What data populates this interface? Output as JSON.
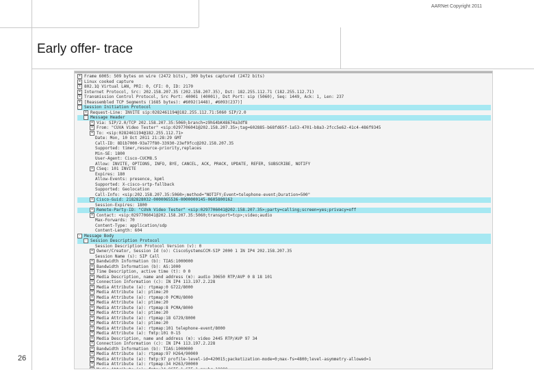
{
  "header": {
    "copyright": "AARNet Copyright 2011"
  },
  "slide": {
    "title": "Early offer- trace",
    "page_number": "26"
  },
  "packet_tree": [
    {
      "indent": 0,
      "expander": "+",
      "text": "Frame 6005: 509 bytes on wire (2472 bits), 309 bytes captured (2472 bits)",
      "highlight": false
    },
    {
      "indent": 0,
      "expander": "+",
      "text": "Linux cooked capture",
      "highlight": false
    },
    {
      "indent": 0,
      "expander": "+",
      "text": "802.1Q Virtual LAN, PRI: 0, CFI: 0, ID: 2170",
      "highlight": false
    },
    {
      "indent": 0,
      "expander": "+",
      "text": "Internet Protocol, Src: 202.158.207.35 (202.158.207.35), Dst: 182.255.112.71 (182.255.112.71)",
      "highlight": false
    },
    {
      "indent": 0,
      "expander": "+",
      "text": "Transmission Control Protocol, Src Port: 40001 (40001), Dst Port: sip (5060), Seq: 1449, Ack: 1, Len: 237",
      "highlight": false
    },
    {
      "indent": 0,
      "expander": "+",
      "text": "[Reassembled TCP Segments (1685 bytes): #6092(1448), #6093(237)]",
      "highlight": false
    },
    {
      "indent": 0,
      "expander": "-",
      "text": "Session Initiation Protocol",
      "highlight": true
    },
    {
      "indent": 1,
      "expander": "+",
      "text": "Request-Line: INVITE sip:0282461194@182.255.112.71:5060 SIP/2.0",
      "highlight": false
    },
    {
      "indent": 1,
      "expander": "-",
      "text": "Message Header",
      "highlight": true
    },
    {
      "indent": 2,
      "expander": "+",
      "text": "Via: SIP/2.0/TCP 202.158.207.35:5060;branch=z9hG4bK48674a3df8",
      "highlight": false
    },
    {
      "indent": 2,
      "expander": "+",
      "text": "From: \"CUVA Video Tester\" <sip:0297706041@202.158.207.35>;tag=602885-b68fd65f-1a53-4701-b8a3-2fcc5e62-41c4-486f9345",
      "highlight": false
    },
    {
      "indent": 2,
      "expander": "+",
      "text": "To: <sip:0282461194@182.255.112.71>",
      "highlight": false
    },
    {
      "indent": 2,
      "expander": "none",
      "text": "Date: Mon, 10 Oct 2011 21:28:29 GMT",
      "highlight": false
    },
    {
      "indent": 2,
      "expander": "none",
      "text": "Call-ID: 8D1b7000-93a77f80-33930-23ef9fcc@202.158.207.35",
      "highlight": false
    },
    {
      "indent": 2,
      "expander": "none",
      "text": "Supported: timer,resource-priority,replaces",
      "highlight": false
    },
    {
      "indent": 2,
      "expander": "none",
      "text": "Min-SE: 1800",
      "highlight": false
    },
    {
      "indent": 2,
      "expander": "none",
      "text": "User-Agent: Cisco-CUCM8.5",
      "highlight": false
    },
    {
      "indent": 2,
      "expander": "none",
      "text": "Allow: INVITE, OPTIONS, INFO, BYE, CANCEL, ACK, PRACK, UPDATE, REFER, SUBSCRIBE, NOTIFY",
      "highlight": false
    },
    {
      "indent": 2,
      "expander": "+",
      "text": "CSeq: 101 INVITE",
      "highlight": false
    },
    {
      "indent": 2,
      "expander": "none",
      "text": "Expires: 180",
      "highlight": false
    },
    {
      "indent": 2,
      "expander": "none",
      "text": "Allow-Events: presence, kpml",
      "highlight": false
    },
    {
      "indent": 2,
      "expander": "none",
      "text": "Supported: X-cisco-srtp-fallback",
      "highlight": false
    },
    {
      "indent": 2,
      "expander": "none",
      "text": "Supported: Geolocation",
      "highlight": false
    },
    {
      "indent": 2,
      "expander": "none",
      "text": "Call-Info: <sip:202.158.207.35:5060>;method=\"NOTIFY;Event=telephone-event;Duration=500\"",
      "highlight": false
    },
    {
      "indent": 2,
      "expander": "+",
      "text": "Cisco-Guid: 2182828032-0000065536-0000000145-0605800162",
      "highlight": true
    },
    {
      "indent": 2,
      "expander": "none",
      "text": "Session-Expires: 1800",
      "highlight": false
    },
    {
      "indent": 2,
      "expander": "+",
      "text": "Remote-Party-ID: \"CUVA Video Tester\" <sip:0297706041@202.158.207.35>;party=calling;screen=yes;privacy=off",
      "highlight": true
    },
    {
      "indent": 2,
      "expander": "+",
      "text": "Contact: <sip:0297706041@202.158.207.35:5060;transport=tcp>;video;audio",
      "highlight": false
    },
    {
      "indent": 2,
      "expander": "none",
      "text": "Max-Forwards: 70",
      "highlight": false
    },
    {
      "indent": 2,
      "expander": "none",
      "text": "Content-Type: application/sdp",
      "highlight": false
    },
    {
      "indent": 2,
      "expander": "none",
      "text": "Content-Length: 604",
      "highlight": false
    },
    {
      "indent": 0,
      "expander": "-",
      "text": "Message Body",
      "highlight": true
    },
    {
      "indent": 1,
      "expander": "-",
      "text": "Session Description Protocol",
      "highlight": true
    },
    {
      "indent": 2,
      "expander": "none",
      "text": "Session Description Protocol Version (v): 0",
      "highlight": false
    },
    {
      "indent": 2,
      "expander": "+",
      "text": "Owner/Creator, Session Id (o): CiscoSystemsCCM-SIP 2000 1 IN IP4 202.158.207.35",
      "highlight": false
    },
    {
      "indent": 2,
      "expander": "none",
      "text": "Session Name (s): SIP Call",
      "highlight": false
    },
    {
      "indent": 2,
      "expander": "+",
      "text": "Bandwidth Information (b): TIAS:1000000",
      "highlight": false
    },
    {
      "indent": 2,
      "expander": "+",
      "text": "Bandwidth Information (b): AS:1000",
      "highlight": false
    },
    {
      "indent": 2,
      "expander": "+",
      "text": "Time Description, active time (t): 0 0",
      "highlight": false
    },
    {
      "indent": 2,
      "expander": "+",
      "text": "Media Description, name and address (m): audio 30650 RTP/AVP 0 8 18 101",
      "highlight": false
    },
    {
      "indent": 2,
      "expander": "+",
      "text": "Connection Information (c): IN IP4 113.197.2.228",
      "highlight": false
    },
    {
      "indent": 2,
      "expander": "+",
      "text": "Media Attribute (a): rtpmap:0 G722/8000",
      "highlight": false
    },
    {
      "indent": 2,
      "expander": "+",
      "text": "Media Attribute (a): ptime:20",
      "highlight": false
    },
    {
      "indent": 2,
      "expander": "+",
      "text": "Media Attribute (a): rtpmap:0 PCMU/8000",
      "highlight": false
    },
    {
      "indent": 2,
      "expander": "+",
      "text": "Media Attribute (a): ptime:20",
      "highlight": false
    },
    {
      "indent": 2,
      "expander": "+",
      "text": "Media Attribute (a): rtpmap:8 PCMA/8000",
      "highlight": false
    },
    {
      "indent": 2,
      "expander": "+",
      "text": "Media Attribute (a): ptime:20",
      "highlight": false
    },
    {
      "indent": 2,
      "expander": "+",
      "text": "Media Attribute (a): rtpmap:18 G729/8000",
      "highlight": false
    },
    {
      "indent": 2,
      "expander": "+",
      "text": "Media Attribute (a): ptime:20",
      "highlight": false
    },
    {
      "indent": 2,
      "expander": "+",
      "text": "Media Attribute (a): rtpmap:101 telephone-event/8000",
      "highlight": false
    },
    {
      "indent": 2,
      "expander": "+",
      "text": "Media Attribute (a): fmtp:101 0-15",
      "highlight": false
    },
    {
      "indent": 2,
      "expander": "+",
      "text": "Media Description, name and address (m): video 2445 RTP/AVP 97 34",
      "highlight": false
    },
    {
      "indent": 2,
      "expander": "+",
      "text": "Connection Information (c): IN IP4 113.197.2.228",
      "highlight": false
    },
    {
      "indent": 2,
      "expander": "+",
      "text": "Bandwidth Information (b): TIAS:1000000",
      "highlight": false
    },
    {
      "indent": 2,
      "expander": "+",
      "text": "Media Attribute (a): rtpmap:97 H264/90000",
      "highlight": false
    },
    {
      "indent": 2,
      "expander": "+",
      "text": "Media Attribute (a): fmtp:97 profile-level-id=420015;packetization-mode=0;max-fs=4800;level-asymmetry-allowed=1",
      "highlight": false
    },
    {
      "indent": 2,
      "expander": "+",
      "text": "Media Attribute (a): rtpmap:34 H263/90000",
      "highlight": false
    },
    {
      "indent": 2,
      "expander": "+",
      "text": "Media Attribute (a): fmtp:34 QCIF=1 CIF=1;maxbr=10000",
      "highlight": false
    }
  ]
}
